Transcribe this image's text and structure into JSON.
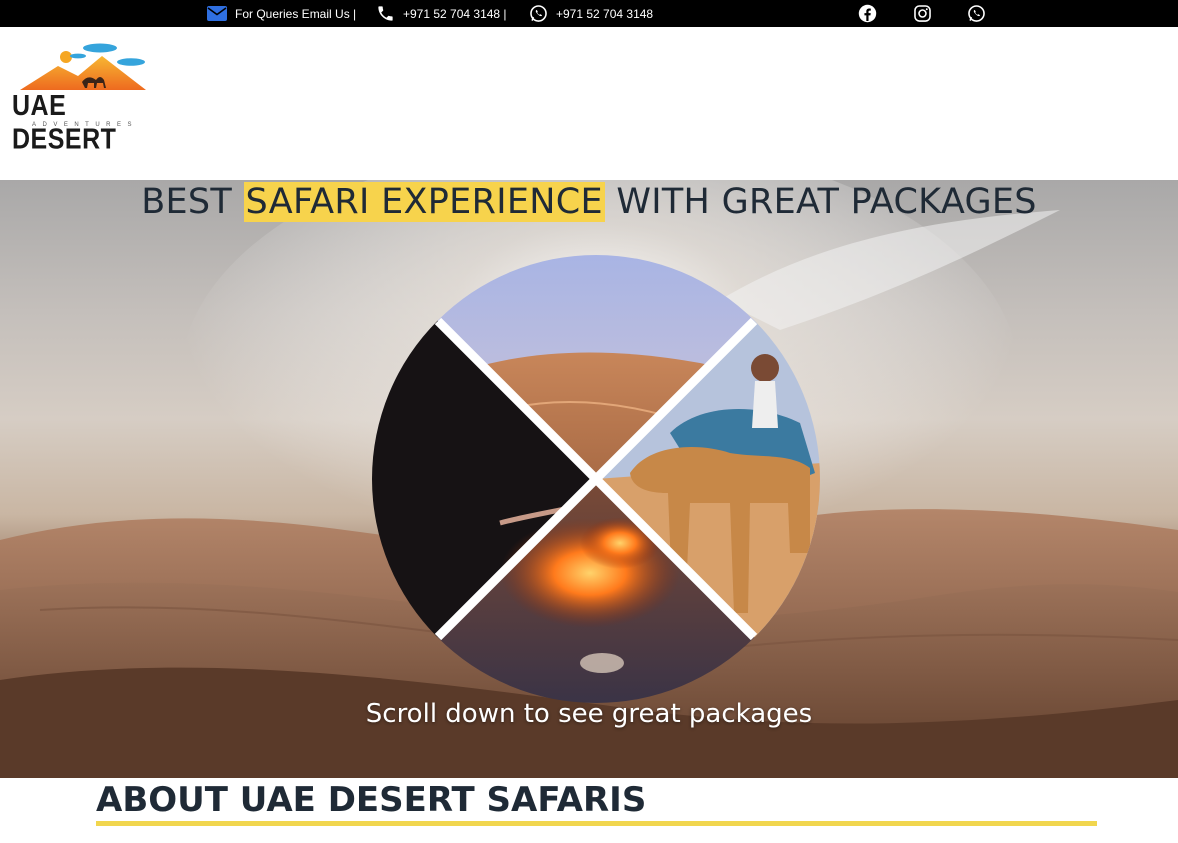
{
  "topbar": {
    "email_label": "For Queries Email Us |",
    "phone_label": "+971 52 704 3148 |",
    "whatsapp_label": "+971 52 704 3148",
    "icons": [
      "envelope-icon",
      "phone-icon",
      "whatsapp-icon",
      "facebook-icon",
      "instagram-icon",
      "whatsapp-icon"
    ]
  },
  "logo": {
    "title": "UAE DESERT",
    "subtitle": "ADVENTURES"
  },
  "hero": {
    "title_before": "BEST ",
    "title_highlight": "SAFARI EXPERIENCE",
    "title_after": " WITH GREAT PACKAGES",
    "subtitle": "Scroll down to see great packages"
  },
  "about": {
    "title": "ABOUT UAE DESERT SAFARIS"
  },
  "colors": {
    "highlight": "#f7d34c",
    "email_icon": "#2f6fe0",
    "rule": "#f1d64e",
    "heading": "#1f2a36"
  }
}
